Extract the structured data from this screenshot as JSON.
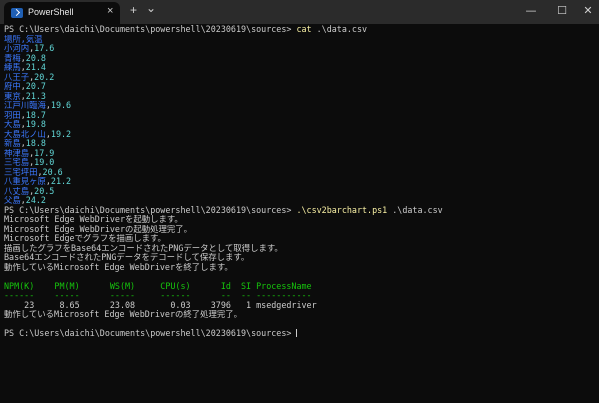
{
  "window": {
    "tab_title": "PowerShell",
    "tab_close": "×",
    "new_tab": "+",
    "dropdown": "⌄",
    "minimize": "—",
    "maximize": "☐",
    "close": "✕"
  },
  "prompt": "PS C:\\Users\\daichi\\Documents\\powershell\\20230619\\sources> ",
  "cmd1": {
    "name": "cat",
    "args": " .\\data.csv"
  },
  "csv_header": "場所,気温",
  "csv_rows": [
    [
      "小河内",
      "17.6"
    ],
    [
      "青梅",
      "20.8"
    ],
    [
      "練馬",
      "21.4"
    ],
    [
      "八王子",
      "20.2"
    ],
    [
      "府中",
      "20.7"
    ],
    [
      "東京",
      "21.3"
    ],
    [
      "江戸川臨海",
      "19.6"
    ],
    [
      "羽田",
      "18.7"
    ],
    [
      "大島",
      "19.8"
    ],
    [
      "大島北ノ山",
      "19.2"
    ],
    [
      "新島",
      "18.8"
    ],
    [
      "神津島",
      "17.9"
    ],
    [
      "三宅島",
      "19.0"
    ],
    [
      "三宅坪田",
      "20.6"
    ],
    [
      "八重見ヶ原",
      "21.2"
    ],
    [
      "八丈島",
      "20.5"
    ],
    [
      "父島",
      "24.2"
    ]
  ],
  "cmd2": {
    "name": ".\\csv2barchart.ps1",
    "args": " .\\data.csv"
  },
  "output_lines": [
    "Microsoft Edge WebDriverを起動します。",
    "Microsoft Edge WebDriverの起動処理完了。",
    "Microsoft Edgeでグラフを描画します。",
    "描画したグラフをBase64エンコードされたPNGデータとして取得します。",
    "Base64エンコードされたPNGデータをデコードして保存します。",
    "動作しているMicrosoft Edge WebDriverを終了します。"
  ],
  "process_table": {
    "header": "NPM(K)    PM(M)      WS(M)     CPU(s)      Id  SI ProcessName",
    "rule": "------    -----      -----     ------      --  -- -----------",
    "row": "    23     8.65      23.08       0.03    3796   1 msedgedriver"
  },
  "final_message": "動作しているMicrosoft Edge WebDriverの終了処理完了。"
}
